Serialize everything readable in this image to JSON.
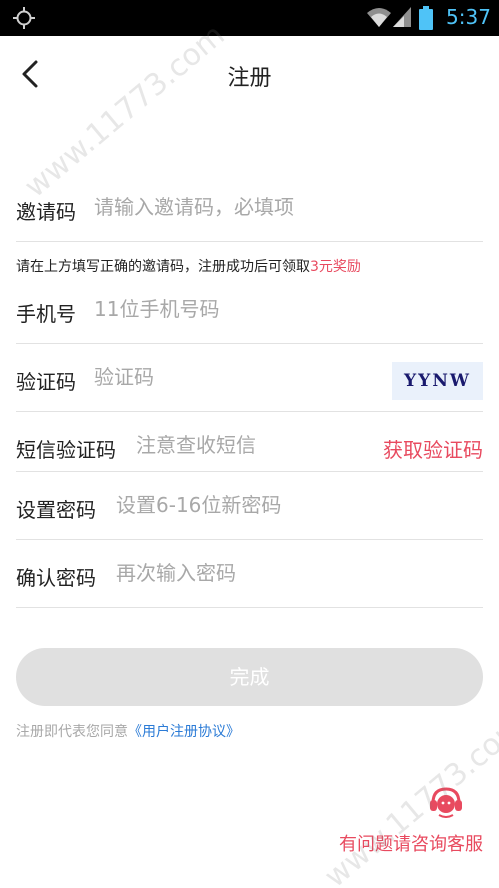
{
  "status_bar": {
    "time": "5:37",
    "icons": [
      "gps-icon",
      "wifi-icon",
      "signal-icon",
      "battery-icon"
    ]
  },
  "header": {
    "title": "注册",
    "back_icon": "chevron-left-icon"
  },
  "form": {
    "invite": {
      "label": "邀请码",
      "placeholder": "请输入邀请码，必填项",
      "value": ""
    },
    "hint": {
      "text": "请在上方填写正确的邀请码，注册成功后可领取",
      "reward": "3元奖励"
    },
    "phone": {
      "label": "手机号",
      "placeholder": "11位手机号码",
      "value": ""
    },
    "captcha": {
      "label": "验证码",
      "placeholder": "验证码",
      "value": "",
      "image_text": "YYNW"
    },
    "sms": {
      "label": "短信验证码",
      "placeholder": "注意查收短信",
      "value": "",
      "get_code_label": "获取验证码"
    },
    "password": {
      "label": "设置密码",
      "placeholder": "设置6-16位新密码",
      "value": ""
    },
    "confirm": {
      "label": "确认密码",
      "placeholder": "再次输入密码",
      "value": ""
    }
  },
  "submit_label": "完成",
  "agreement": {
    "prefix": "注册即代表您同意",
    "link": "《用户注册协议》"
  },
  "support": {
    "label": "有问题请咨询客服",
    "icon": "customer-service-icon"
  },
  "watermark": "www.11773.com",
  "colors": {
    "accent": "#e84a5f",
    "link": "#2b7bd6",
    "button_disabled": "#e0e0e0",
    "placeholder": "#a8a8a8"
  }
}
